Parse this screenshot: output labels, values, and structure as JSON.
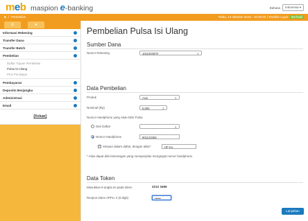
{
  "brand": {
    "logo_main": "m",
    "logo_dot": "e",
    "logo_tail": "b",
    "logo_sub_prefix": "maspion",
    "logo_sub_e": "e",
    "logo_sub_suffix": "-banking"
  },
  "language": {
    "label": "Bahasa",
    "value": "Indonesia"
  },
  "topbar": {
    "home_label": "Pembelian",
    "info_text": "Rabu, 13 Oktober 2015 - 10:25:02 | Terakhir Login: ",
    "info_highlight": "Berhasil"
  },
  "sidebar": {
    "tab1": "",
    "tab2": "",
    "items": [
      {
        "label": "Informasi Rekening"
      },
      {
        "label": "Transfer Dana"
      },
      {
        "label": "Transfer Batch"
      },
      {
        "label": "Pembelian"
      }
    ],
    "sub_items": [
      {
        "label": "Daftar Tujuan Pembelian"
      },
      {
        "label": "Pulsa Isi Ulang"
      },
      {
        "label": "PLN Pra Bayar"
      }
    ],
    "items2": [
      {
        "label": "Pembayaran"
      },
      {
        "label": "Deposito Berjangka"
      },
      {
        "label": "Administrasi"
      },
      {
        "label": "Email"
      }
    ],
    "logout": "[Keluar]"
  },
  "main": {
    "title": "Pembelian Pulsa Isi Ulang",
    "sumber_dana": {
      "title": "Sumber Dana",
      "label": "Nomor Rekening",
      "value": "1011004970"
    },
    "data_pembelian": {
      "title": "Data Pembelian",
      "produk_label": "Produk",
      "produk_value": "Axis",
      "nominal_label": "Nominal (Rp)",
      "nominal_value": "5,000",
      "nomor_hp_label": "Nomor Handphone yang Akan Diisi Pulsa",
      "dari_daftar_label": "Dari Daftar",
      "nomor_handphone_label": "Nomor Handphone",
      "nomor_handphone_value": "901123456",
      "simpan_label": "Simpan dalam daftar, dengan alias*",
      "simpan_value": "HP Ku",
      "note": "* Alias dapat diisi keterangan yang memperjelas mengingat nomor handphone."
    },
    "data_token": {
      "title": "Data Token",
      "masukkan_label": "Masukkan 8 angka ini pada token",
      "masukkan_value": "2212 3456",
      "respon_label": "Respon token APPLI 2 (6 digit)",
      "respon_value": "••••••"
    },
    "submit_label": "Lanjutkan"
  },
  "colors": {
    "orange": "#f29c1f",
    "blue": "#1a7abf"
  }
}
